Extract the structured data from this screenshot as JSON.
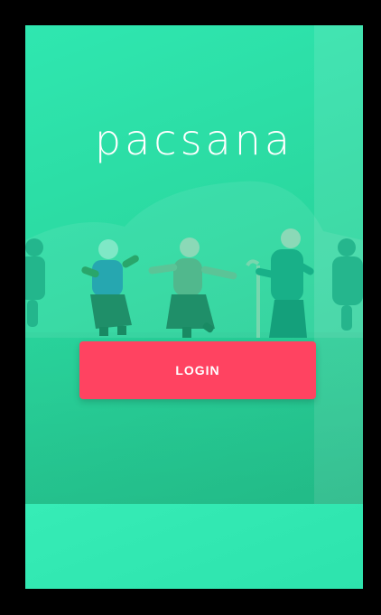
{
  "app": {
    "logo_text": "pacsana",
    "login_label": "LOGIN"
  },
  "colors": {
    "primary_teal": "#2ad79e",
    "accent_red": "#ff4361"
  },
  "illustration": {
    "icon_name": "elderly-people-dancing-illustration"
  }
}
